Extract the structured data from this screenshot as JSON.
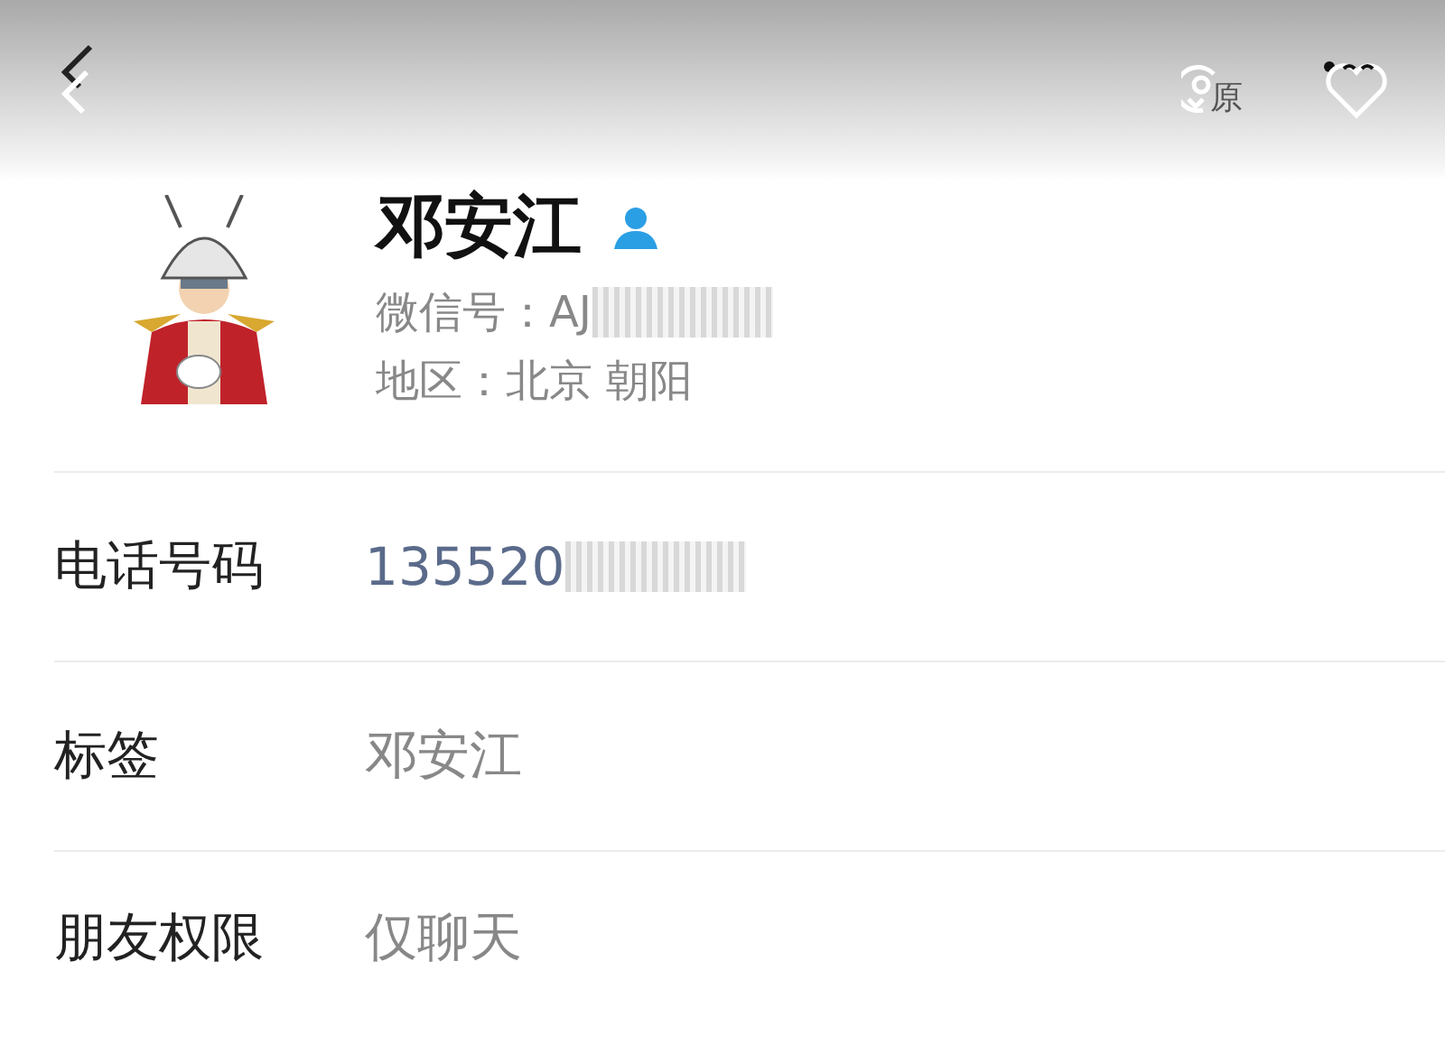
{
  "top_bar": {
    "original_badge": "原"
  },
  "profile": {
    "name": "邓安江",
    "wechat_id": "微信号：AJ",
    "wechat_id_redacted": true,
    "region": "地区：北京 朝阳"
  },
  "rows": [
    {
      "label": "电话号码",
      "value": "135520",
      "kind": "phone",
      "redacted": true
    },
    {
      "label": "标签",
      "value": "邓安江",
      "kind": "plain",
      "redacted": false
    },
    {
      "label": "朋友权限",
      "value": "仅聊天",
      "kind": "plain",
      "redacted": false
    }
  ]
}
